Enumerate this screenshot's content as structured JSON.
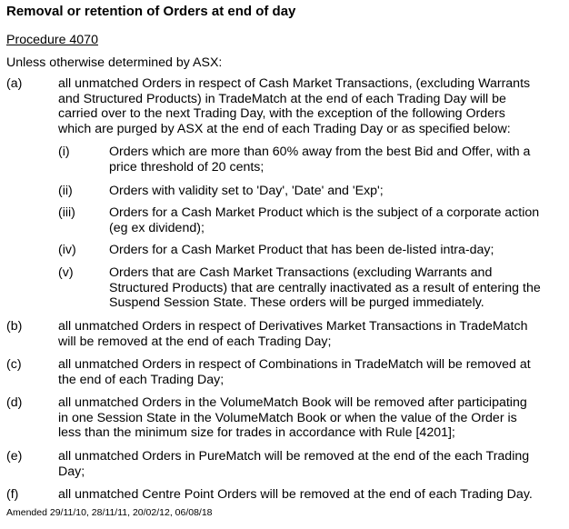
{
  "title": "Removal or retention of Orders at end of day",
  "procedure": "Procedure 4070",
  "intro": "Unless otherwise determined by ASX:",
  "items": [
    {
      "label": "(a)",
      "lines": [
        "all unmatched Orders in respect of Cash Market Transactions, (excluding Warrants",
        "and Structured Products) in TradeMatch at the end of each Trading Day will be",
        "carried over to the next Trading Day, with the exception of the following Orders",
        "which are purged by ASX at the end of each Trading Day or as specified below:"
      ],
      "subitems": [
        {
          "label": "(i)",
          "lines": [
            "Orders which are more than 60% away from the best Bid and Offer, with a",
            "price threshold of 20 cents;"
          ]
        },
        {
          "label": "(ii)",
          "lines": [
            "Orders with validity set to 'Day', 'Date' and 'Exp';"
          ]
        },
        {
          "label": "(iii)",
          "lines": [
            "Orders for a Cash Market Product which is the subject of a corporate action",
            "(eg ex dividend);"
          ]
        },
        {
          "label": "(iv)",
          "lines": [
            "Orders for a Cash Market Product that has been de-listed intra-day;"
          ]
        },
        {
          "label": "(v)",
          "lines": [
            "Orders that are Cash Market Transactions (excluding Warrants and",
            "Structured Products) that are centrally inactivated as a result of entering the",
            "Suspend Session State.  These orders will be purged immediately."
          ]
        }
      ]
    },
    {
      "label": "(b)",
      "lines": [
        "all unmatched Orders in respect of Derivatives Market Transactions in TradeMatch",
        "will be removed at the end of each Trading Day;"
      ]
    },
    {
      "label": "(c)",
      "lines": [
        "all unmatched Orders in respect of Combinations in TradeMatch will be removed at",
        "the end of each Trading Day;"
      ]
    },
    {
      "label": "(d)",
      "lines": [
        "all unmatched Orders in the VolumeMatch Book will be removed after participating",
        "in one Session State in the VolumeMatch Book or when the value of the Order is",
        "less than the minimum size for trades in accordance with Rule [4201];"
      ]
    },
    {
      "label": "(e)",
      "lines": [
        "all unmatched Orders in PureMatch will be removed at the end of the each Trading",
        "Day;"
      ]
    },
    {
      "label": "(f)",
      "lines": [
        "all unmatched Centre Point Orders will be removed at the end of each Trading Day."
      ]
    }
  ],
  "amended": "Amended 29/11/10, 28/11/11, 20/02/12, 06/08/18"
}
